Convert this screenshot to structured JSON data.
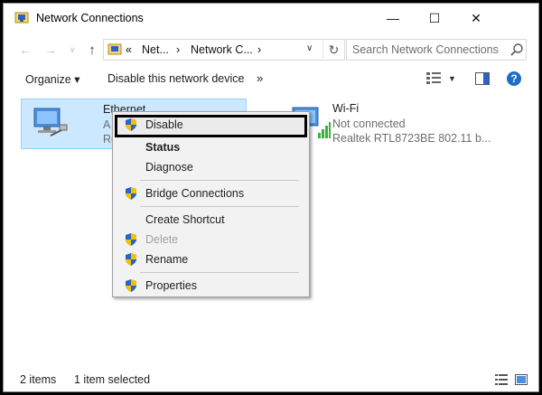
{
  "window": {
    "title": "Network Connections"
  },
  "titlebar_buttons": {
    "minimize": "—",
    "maximize": "☐",
    "close": "✕"
  },
  "nav": {
    "back": "←",
    "forward": "→",
    "recent": "∨",
    "up": "↑"
  },
  "address": {
    "prefix": "«",
    "segment1": "Net...",
    "sep1": "›",
    "segment2": "Network C...",
    "sep2": "›",
    "dropdown": "∨",
    "refresh": "↻"
  },
  "search": {
    "placeholder": "Search Network Connections"
  },
  "toolbar": {
    "organize_label": "Organize ▾",
    "disable_label": "Disable this network device",
    "more_label": "»",
    "view_dropdown": "▼",
    "help_label": "?"
  },
  "items": [
    {
      "name": "Ethernet",
      "status": "A",
      "device": "Re"
    },
    {
      "name": "Wi-Fi",
      "status": "Not connected",
      "device": "Realtek RTL8723BE 802.11 b..."
    }
  ],
  "context_menu": {
    "items": [
      {
        "label": "Disable",
        "shield": true
      },
      {
        "label": "Status",
        "bold": true
      },
      {
        "label": "Diagnose"
      },
      {
        "label": "Bridge Connections",
        "shield": true
      },
      {
        "label": "Create Shortcut"
      },
      {
        "label": "Delete",
        "shield": true,
        "disabled": true
      },
      {
        "label": "Rename",
        "shield": true
      },
      {
        "label": "Properties",
        "shield": true
      }
    ]
  },
  "status": {
    "count": "2 items",
    "selection": "1 item selected"
  },
  "colors": {
    "selection_bg": "#cce8ff",
    "selection_border": "#99d1ff",
    "help_blue": "#1c6ec9",
    "shield_blue": "#2a62c9",
    "shield_yellow": "#f2c200",
    "wifi_bars": "#3cb043"
  }
}
